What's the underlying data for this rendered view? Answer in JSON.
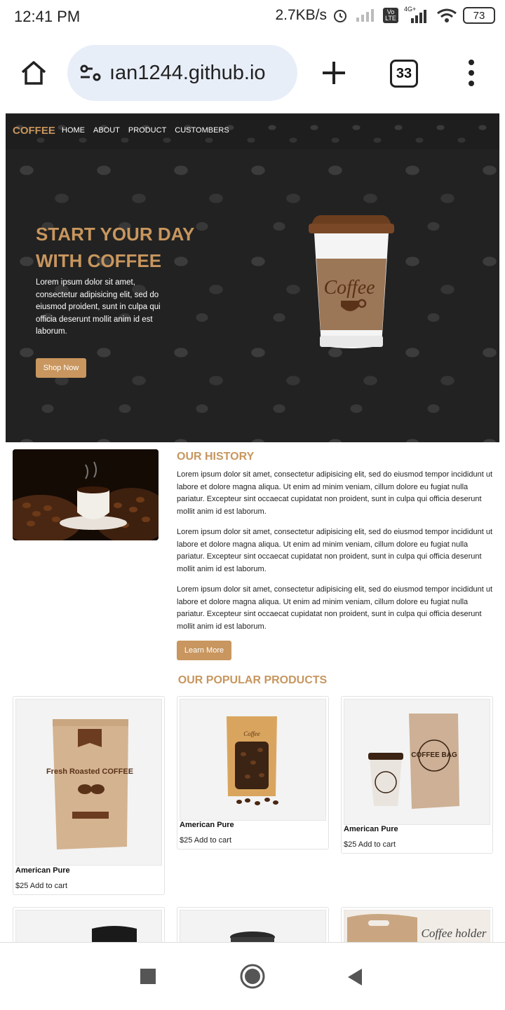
{
  "status_bar": {
    "time": "12:41 PM",
    "speed": "2.7KB/s",
    "network": "4G+",
    "volte": "Vo LTE",
    "battery": "73"
  },
  "browser": {
    "url": "ıan1244.github.io",
    "tab_count": "33"
  },
  "site": {
    "brand": "COFFEE",
    "nav": [
      "HOME",
      "ABOUT",
      "PRODUCT",
      "CUSTOMBERS"
    ],
    "hero": {
      "title_line1": "START YOUR DAY",
      "title_line2": "WITH COFFEE",
      "text": "Lorem ipsum dolor sit amet, consectetur adipisicing elit, sed do eiusmod proident, sunt in culpa qui officia deserunt mollit anim id est laborum.",
      "button": "Shop Now",
      "cup_label": "Coffee"
    },
    "history": {
      "title": "OUR HISTORY",
      "paragraphs": [
        "Lorem ipsum dolor sit amet, consectetur adipisicing elit, sed do eiusmod tempor incididunt ut labore et dolore magna aliqua. Ut enim ad minim veniam, cillum dolore eu fugiat nulla pariatur. Excepteur sint occaecat cupidatat non proident, sunt in culpa qui officia deserunt mollit anim id est laborum.",
        "Lorem ipsum dolor sit amet, consectetur adipisicing elit, sed do eiusmod tempor incididunt ut labore et dolore magna aliqua. Ut enim ad minim veniam, cillum dolore eu fugiat nulla pariatur. Excepteur sint occaecat cupidatat non proident, sunt in culpa qui officia deserunt mollit anim id est laborum.",
        "Lorem ipsum dolor sit amet, consectetur adipisicing elit, sed do eiusmod tempor incididunt ut labore et dolore magna aliqua. Ut enim ad minim veniam, cillum dolore eu fugiat nulla pariatur. Excepteur sint occaecat cupidatat non proident, sunt in culpa qui officia deserunt mollit anim id est laborum."
      ],
      "button": "Learn More"
    },
    "products": {
      "title": "OUR POPULAR PRODUCTS",
      "items": [
        {
          "name": "American Pure",
          "price": "$25 Add to cart",
          "package_text": "Fresh Roasted COFFEE"
        },
        {
          "name": "American Pure",
          "price": "$25 Add to cart",
          "package_text": "Coffee"
        },
        {
          "name": "American Pure",
          "price": "$25 Add to cart",
          "package_text": "COFFEE BAG"
        }
      ],
      "partial_label": "Coffee holder"
    }
  }
}
